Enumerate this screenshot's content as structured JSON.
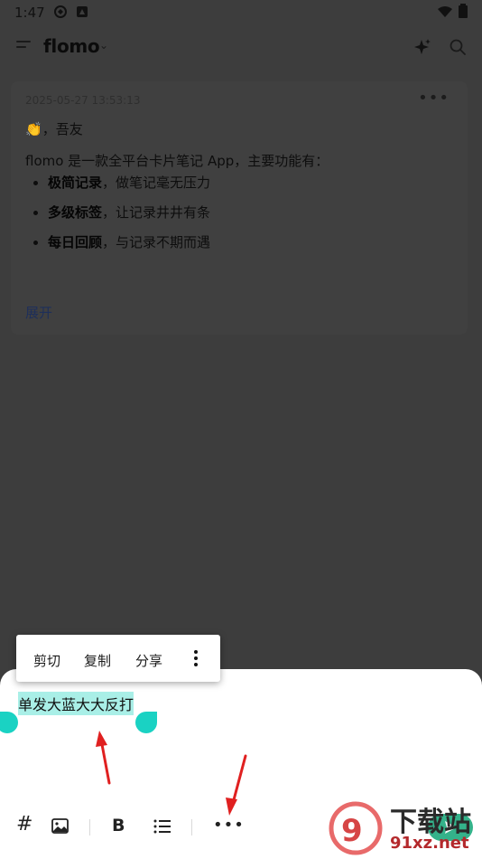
{
  "status_bar": {
    "time": "1:47"
  },
  "app_bar": {
    "brand": "flomo",
    "caret": "⌄"
  },
  "memo": {
    "timestamp": "2025-05-27 13:53:13",
    "more": "•••",
    "greeting_emoji": "👏",
    "greeting_text": "，吾友",
    "intro": "flomo 是一款全平台卡片笔记 App，主要功能有：",
    "features": [
      {
        "bold": "极简记录",
        "rest": "，做笔记毫无压力"
      },
      {
        "bold": "多级标签",
        "rest": "，让记录井井有条"
      },
      {
        "bold": "每日回顾",
        "rest": "，与记录不期而遇"
      }
    ],
    "expand_label": "展开"
  },
  "context_menu": {
    "cut": "剪切",
    "copy": "复制",
    "share": "分享"
  },
  "editor": {
    "selected_text": "单发大蓝大大反打"
  },
  "toolbar": {
    "hash": "#",
    "bold": "B",
    "more": "•••"
  },
  "watermark": {
    "title": "下载站",
    "url": "91xz.net"
  },
  "colors": {
    "accent": "#34b28a",
    "selection_handle": "#1ad2c3",
    "selection_bg": "#a9efe7",
    "annotation_arrow": "#e02020",
    "link": "#1e2f5a"
  },
  "icons": [
    "menu-icon",
    "chevron-down-icon",
    "sparkle-icon",
    "search-icon",
    "hash-icon",
    "image-icon",
    "bold-icon",
    "list-icon",
    "more-icon",
    "send-icon",
    "kebab-icon",
    "wifi-icon",
    "battery-icon"
  ]
}
